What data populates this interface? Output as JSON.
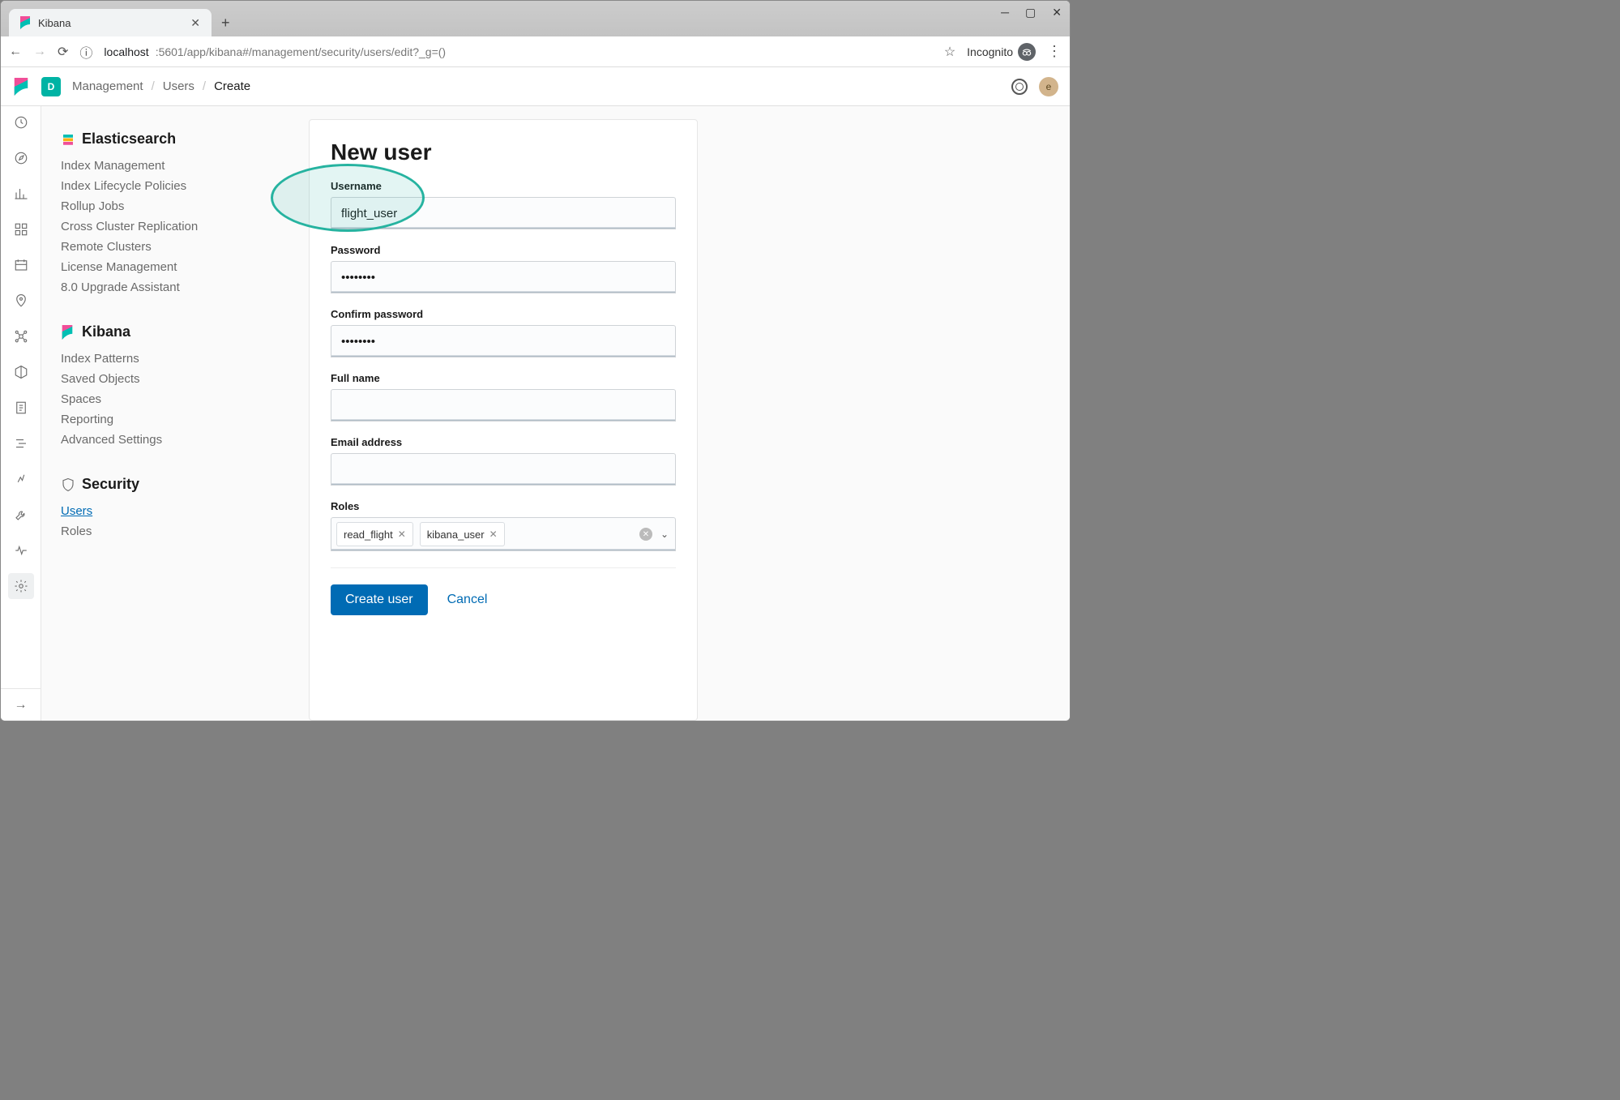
{
  "browser": {
    "tab_title": "Kibana",
    "url_origin": "localhost",
    "url_path": ":5601/app/kibana#/management/security/users/edit?_g=()",
    "incognito_label": "Incognito"
  },
  "header": {
    "space_letter": "D",
    "breadcrumb": {
      "management": "Management",
      "users": "Users",
      "create": "Create"
    },
    "avatar_letter": "e"
  },
  "sidebar": {
    "groups": [
      {
        "title": "Elasticsearch",
        "icon": "elasticsearch-icon",
        "items": [
          {
            "label": "Index Management"
          },
          {
            "label": "Index Lifecycle Policies"
          },
          {
            "label": "Rollup Jobs"
          },
          {
            "label": "Cross Cluster Replication"
          },
          {
            "label": "Remote Clusters"
          },
          {
            "label": "License Management"
          },
          {
            "label": "8.0 Upgrade Assistant"
          }
        ]
      },
      {
        "title": "Kibana",
        "icon": "kibana-icon",
        "items": [
          {
            "label": "Index Patterns"
          },
          {
            "label": "Saved Objects"
          },
          {
            "label": "Spaces"
          },
          {
            "label": "Reporting"
          },
          {
            "label": "Advanced Settings"
          }
        ]
      },
      {
        "title": "Security",
        "icon": "shield-icon",
        "items": [
          {
            "label": "Users",
            "selected": true
          },
          {
            "label": "Roles"
          }
        ]
      }
    ]
  },
  "form": {
    "title": "New user",
    "username_label": "Username",
    "username_value": "flight_user",
    "password_label": "Password",
    "password_value": "••••••••",
    "confirm_label": "Confirm password",
    "confirm_value": "••••••••",
    "fullname_label": "Full name",
    "fullname_value": "",
    "email_label": "Email address",
    "email_value": "",
    "roles_label": "Roles",
    "roles": [
      {
        "label": "read_flight"
      },
      {
        "label": "kibana_user"
      }
    ],
    "create_btn": "Create user",
    "cancel_btn": "Cancel"
  }
}
